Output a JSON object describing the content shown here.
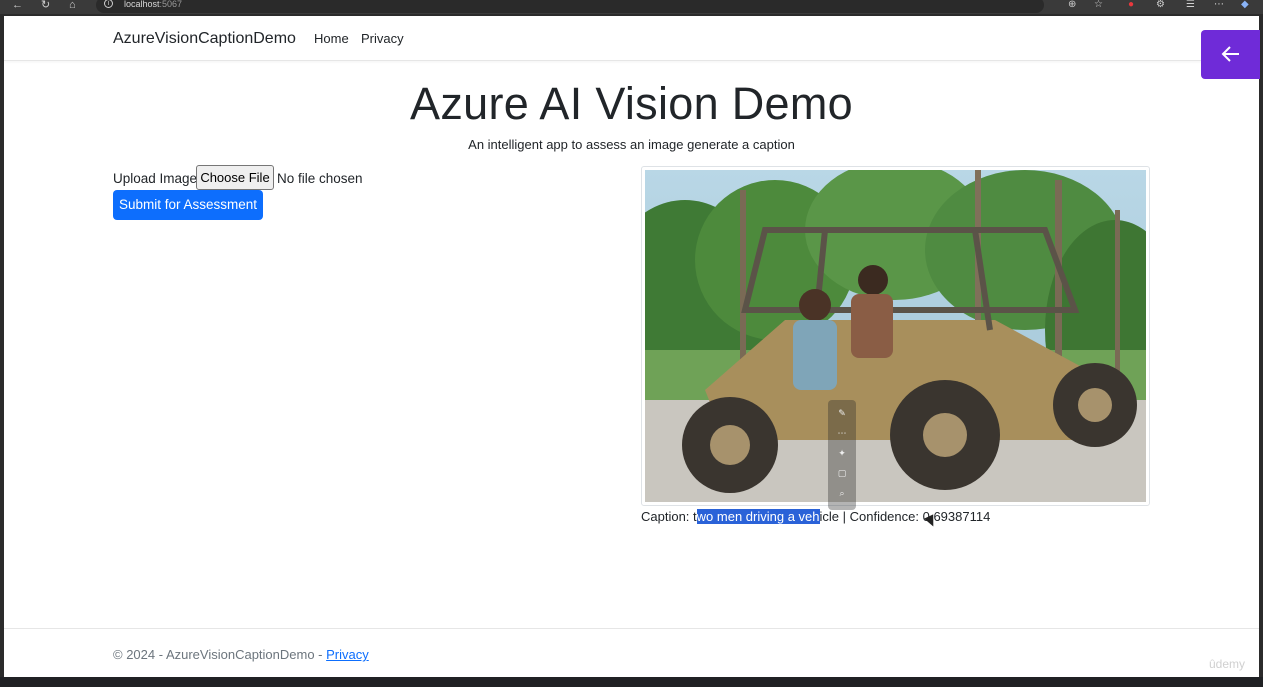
{
  "browser": {
    "url_host": "localhost",
    "url_port": ":5067"
  },
  "navbar": {
    "brand": "AzureVisionCaptionDemo",
    "links": [
      "Home",
      "Privacy"
    ]
  },
  "main": {
    "title": "Azure AI Vision Demo",
    "subtitle": "An intelligent app to assess an image generate a caption",
    "upload_label": "Upload Image",
    "file_button": "Choose File",
    "file_status": "No file chosen",
    "submit_label": "Submit for Assessment",
    "image_alt": "two men driving a vehicle",
    "caption_prefix": "Caption: t",
    "caption_selected": "wo men driving a veh",
    "caption_suffix": "icle | Confidence: 0.69387114"
  },
  "footer": {
    "text": "© 2024 - AzureVisionCaptionDemo - ",
    "link": "Privacy"
  },
  "watermark": "ûdemy",
  "colors": {
    "primary": "#0d6efd",
    "selection": "#2a62d8",
    "float_button": "#6f2bd8"
  },
  "icons": {
    "back": "arrow-left-icon",
    "reload": "reload-icon",
    "home": "home-icon",
    "info": "info-icon"
  }
}
